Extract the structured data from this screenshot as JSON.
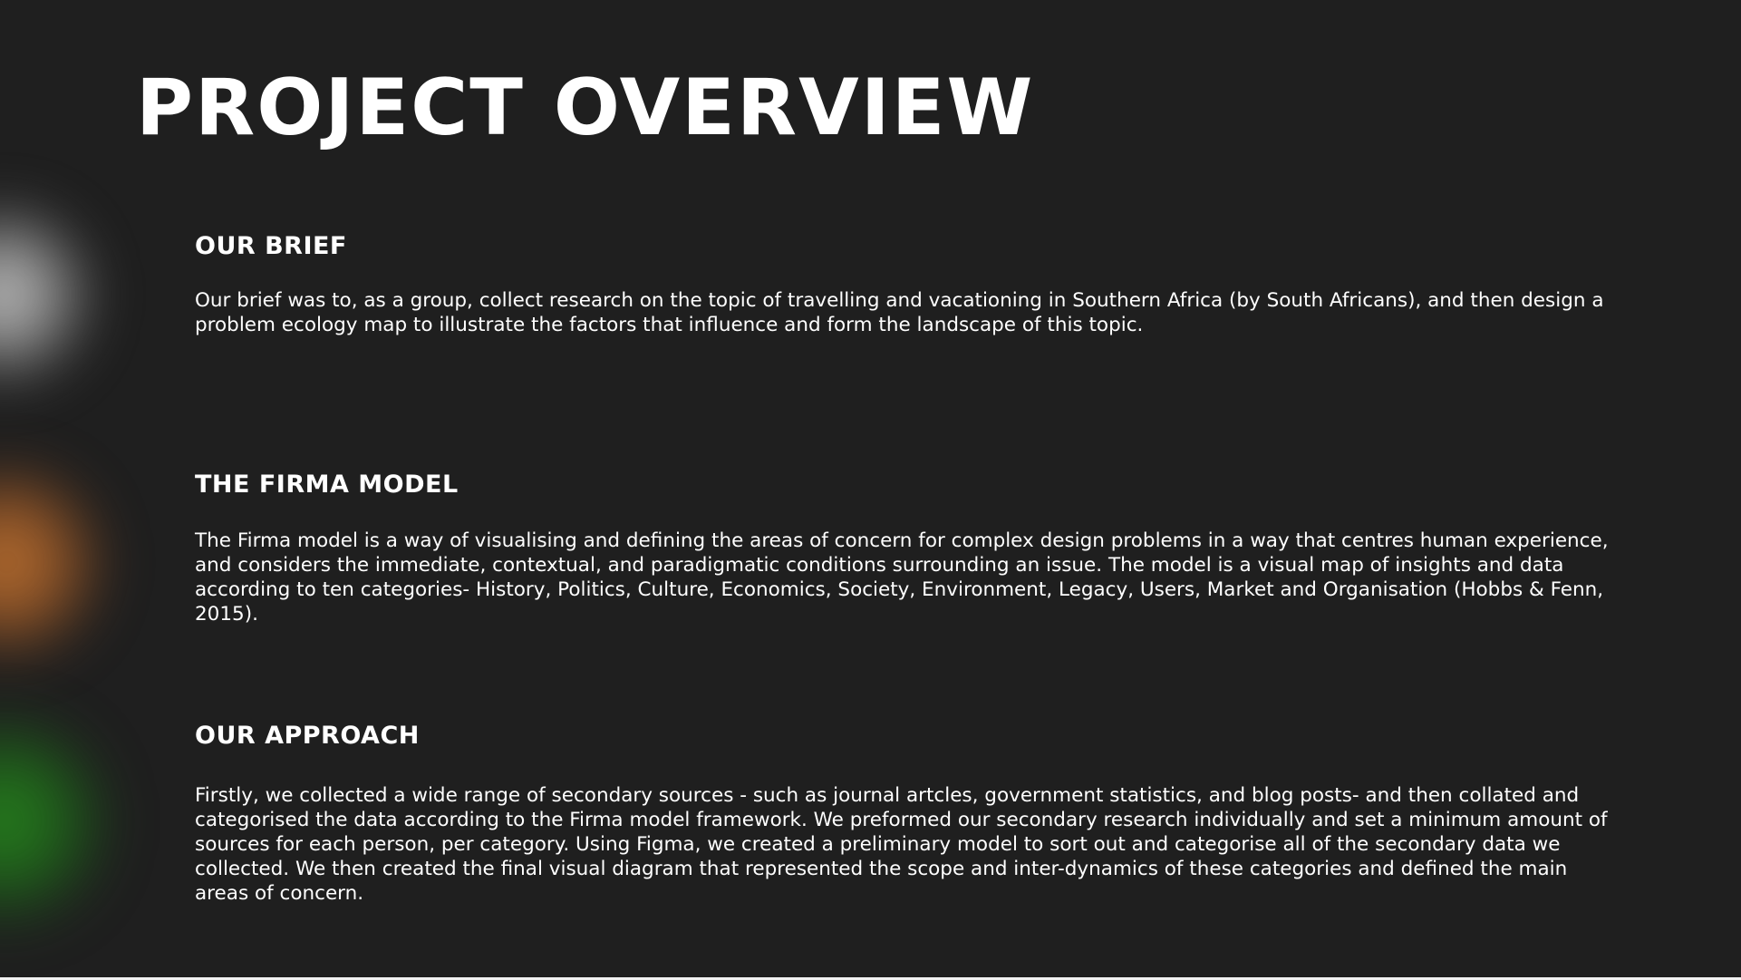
{
  "slide": {
    "title": "PROJECT OVERVIEW",
    "sections": [
      {
        "heading": "OUR BRIEF",
        "body": "Our brief was to, as a group, collect research on the topic of travelling and vacationing in Southern Africa (by South Africans), and then design a problem ecology map to illustrate the factors that influence and form the landscape of this topic."
      },
      {
        "heading": "THE FIRMA MODEL",
        "body": "The Firma model is a way of visualising and defining the areas of concern for complex design problems in a way that centres human experience, and considers the immediate, contextual, and paradigmatic conditions surrounding an issue. The model is a visual map of insights and data according to ten categories- History, Politics, Culture, Economics, Society, Environment, Legacy, Users, Market and Organisation (Hobbs & Fenn, 2015)."
      },
      {
        "heading": "OUR APPROACH",
        "body": "Firstly, we collected a wide range of secondary sources - such as journal artcles, government statistics, and blog posts- and then collated and categorised the data according to the Firma model framework. We preformed our secondary research individually and set a minimum amount of sources for each person, per category. Using Figma, we created a preliminary model to sort out and categorise all of the secondary data we collected. We then created the final visual diagram that represented the scope and inter-dynamics of these categories and defined the main areas of concern."
      }
    ]
  },
  "colors": {
    "background": "#1f1f1f",
    "text": "#ffffff",
    "glow_white": "#d2d2d2",
    "glow_orange": "#c87832",
    "glow_green": "#288c1e"
  }
}
